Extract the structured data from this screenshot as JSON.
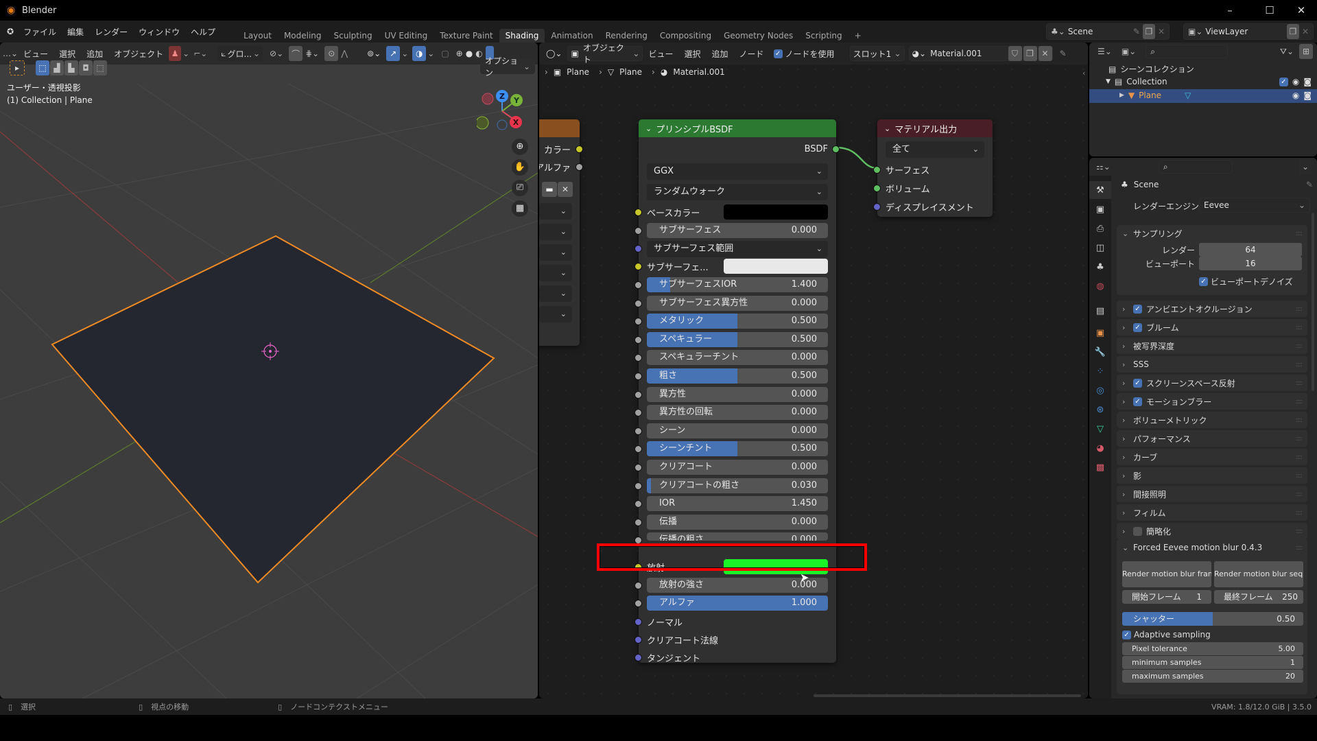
{
  "window": {
    "title": "Blender",
    "minimize": "–",
    "maximize": "☐",
    "close": "✕"
  },
  "menubar": {
    "items": [
      "ファイル",
      "編集",
      "レンダー",
      "ウィンドウ",
      "ヘルプ"
    ],
    "workspaces": [
      "Layout",
      "Modeling",
      "Sculpting",
      "UV Editing",
      "Texture Paint",
      "Shading",
      "Animation",
      "Rendering",
      "Compositing",
      "Geometry Nodes",
      "Scripting"
    ],
    "active_workspace": "Shading",
    "add_workspace": "+",
    "scene": "Scene",
    "view_layer": "ViewLayer"
  },
  "viewport": {
    "menu": [
      "ビュー",
      "選択",
      "追加",
      "オブジェクト"
    ],
    "transform_orientation": "グロ...",
    "options": "オプション",
    "view_name": "ユーザー・透視投影",
    "context": "(1) Collection | Plane",
    "gizmo": {
      "x": "X",
      "y": "Y",
      "z": "Z"
    }
  },
  "node_editor": {
    "object_mode": "オブジェクト",
    "menu": [
      "ビュー",
      "選択",
      "追加",
      "ノード"
    ],
    "use_nodes_label": "ノードを使用",
    "use_nodes": true,
    "slot": "スロット1",
    "material": "Material.001",
    "breadcrumb": [
      "Plane",
      "Plane",
      "Material.001"
    ],
    "image_node": {
      "outputs": [
        "カラー",
        "アルファ"
      ]
    },
    "bsdf": {
      "title": "プリンシプルBSDF",
      "output": "BSDF",
      "distribution": "GGX",
      "subsurface_method": "ランダムウォーク",
      "base_color_label": "ベースカラー",
      "base_color": "#000000",
      "subsurface_radius": "サブサーフェス範囲",
      "subsurface_color_label": "サブサーフェ...",
      "subsurface_color": "#e8e8e8",
      "sliders_a": [
        {
          "label": "サブサーフェス",
          "value": "0.000",
          "fill": 0
        },
        {
          "label": "サブサーフェスIOR",
          "value": "1.400",
          "fill": 0.13
        },
        {
          "label": "サブサーフェス異方性",
          "value": "0.000",
          "fill": 0
        },
        {
          "label": "メタリック",
          "value": "0.500",
          "fill": 0.5
        },
        {
          "label": "スペキュラー",
          "value": "0.500",
          "fill": 0.5
        },
        {
          "label": "スペキュラーチント",
          "value": "0.000",
          "fill": 0
        },
        {
          "label": "粗さ",
          "value": "0.500",
          "fill": 0.5
        },
        {
          "label": "異方性",
          "value": "0.000",
          "fill": 0
        },
        {
          "label": "異方性の回転",
          "value": "0.000",
          "fill": 0
        },
        {
          "label": "シーン",
          "value": "0.000",
          "fill": 0
        },
        {
          "label": "シーンチント",
          "value": "0.500",
          "fill": 0.5
        },
        {
          "label": "クリアコート",
          "value": "0.000",
          "fill": 0
        },
        {
          "label": "クリアコートの粗さ",
          "value": "0.030",
          "fill": 0.03
        },
        {
          "label": "IOR",
          "value": "1.450",
          "fill": 0
        },
        {
          "label": "伝播",
          "value": "0.000",
          "fill": 0
        },
        {
          "label": "伝播の粗さ",
          "value": "0.000",
          "fill": 0
        }
      ],
      "emission_label": "放射",
      "emission_color": "#19f526",
      "emission_strength": {
        "label": "放射の強さ",
        "value": "0.000"
      },
      "alpha": {
        "label": "アルファ",
        "value": "1.000",
        "fill": 1
      },
      "vector_inputs": [
        "ノーマル",
        "クリアコート法線",
        "タンジェント"
      ]
    },
    "output_node": {
      "title": "マテリアル出力",
      "target": "全て",
      "inputs": [
        "サーフェス",
        "ボリューム",
        "ディスプレイスメント"
      ]
    },
    "highlight_color": "#ff0000"
  },
  "outliner": {
    "scene_collection": "シーンコレクション",
    "collection": "Collection",
    "object": "Plane"
  },
  "properties": {
    "scene": "Scene",
    "render_engine_label": "レンダーエンジン",
    "render_engine": "Eevee",
    "sampling": {
      "title": "サンプリング",
      "render_label": "レンダー",
      "render": "64",
      "viewport_label": "ビューポート",
      "viewport": "16",
      "denoise_label": "ビューポートデノイズ",
      "denoise": true
    },
    "panels": [
      {
        "label": "アンビエントオクルージョン",
        "checkbox": true
      },
      {
        "label": "ブルーム",
        "checkbox": true
      },
      {
        "label": "被写界深度",
        "checkbox": null
      },
      {
        "label": "SSS",
        "checkbox": null
      },
      {
        "label": "スクリーンスペース反射",
        "checkbox": true
      },
      {
        "label": "モーションブラー",
        "checkbox": true
      },
      {
        "label": "ボリューメトリック",
        "checkbox": null
      },
      {
        "label": "パフォーマンス",
        "checkbox": null
      },
      {
        "label": "カーブ",
        "checkbox": null
      },
      {
        "label": "影",
        "checkbox": null
      },
      {
        "label": "間接照明",
        "checkbox": null
      },
      {
        "label": "フィルム",
        "checkbox": null
      },
      {
        "label": "簡略化",
        "checkbox": false
      }
    ],
    "addon": {
      "title": "Forced Eevee motion blur 0.4.3",
      "btn_frame": "Render motion blur frame",
      "btn_seq": "Render motion blur seq...",
      "start_label": "開始フレーム",
      "start": "1",
      "end_label": "最終フレーム",
      "end": "250",
      "shutter_label": "シャッター",
      "shutter": "0.50",
      "shutter_fill": 0.5,
      "adaptive_label": "Adaptive sampling",
      "adaptive": true,
      "pixel_tol_label": "Pixel tolerance",
      "pixel_tol": "5.00",
      "min_label": "minimum samples",
      "min": "1",
      "max_label": "maximum samples",
      "max": "20"
    }
  },
  "status": {
    "select": "選択",
    "pan": "視点の移動",
    "context_menu": "ノードコンテクストメニュー",
    "vram": "VRAM: 1.8/12.0 GiB | 3.5.0"
  }
}
